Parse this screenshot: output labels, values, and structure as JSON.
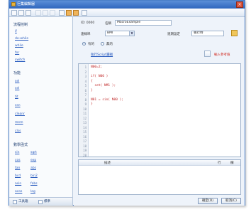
{
  "window": {
    "title": "巨集編輯器"
  },
  "toolbar": {
    "buttons": [
      "new-icon",
      "open-icon",
      "save-icon",
      "cut-icon",
      "copy-icon",
      "paste-icon",
      "find-icon",
      "compile-icon",
      "run-icon",
      "help-icon"
    ]
  },
  "sidebar": {
    "groups": [
      {
        "title": "流程控制",
        "links": [
          "if",
          "do-while",
          "while",
          "for",
          "switch"
        ]
      },
      {
        "title": "功能",
        "links": [
          "sel",
          "sel",
          "tit",
          "ssn",
          "cleanr",
          "mem",
          "clss"
        ]
      }
    ],
    "math_title": "數學函式",
    "math_links": [
      [
        "sin",
        "sqrt"
      ],
      [
        "cos",
        "exp"
      ],
      [
        "tan",
        "abs"
      ],
      [
        "bcd",
        "bin2"
      ],
      [
        "asin",
        "fabs"
      ],
      [
        "acos",
        "log"
      ],
      [
        "atan",
        ""
      ]
    ],
    "tabs": [
      "工具箱",
      "標準"
    ]
  },
  "form": {
    "id_label": "ID: 0000",
    "name_label": "名稱",
    "name_value": "MacroExample",
    "device_label": "連線埠",
    "device_value": "BMI",
    "period_label": "週期設定",
    "period_value": "執行時",
    "radio_on": "有的",
    "radio_off": "無的",
    "link_label": "執行Script邏輯",
    "help_label": "輸入參考值"
  },
  "editor": {
    "line_numbers": [
      "1",
      "2",
      "3",
      "4",
      "5",
      "6",
      "7",
      "8",
      "9",
      "10",
      "11",
      "12",
      "13",
      "14",
      "15",
      "16",
      "17",
      "18",
      "19",
      "20"
    ],
    "code_lines": [
      "N00=2;",
      "",
      "if( N00 )",
      "{",
      "  set( NM1 );",
      "}",
      "",
      "N01 = sin( N00 );",
      "}"
    ]
  },
  "output": {
    "col_desc": "描述",
    "col_line": "行",
    "col_no": "欄"
  },
  "buttons": {
    "ok": "確定(O)",
    "cancel": "取消(C)"
  }
}
